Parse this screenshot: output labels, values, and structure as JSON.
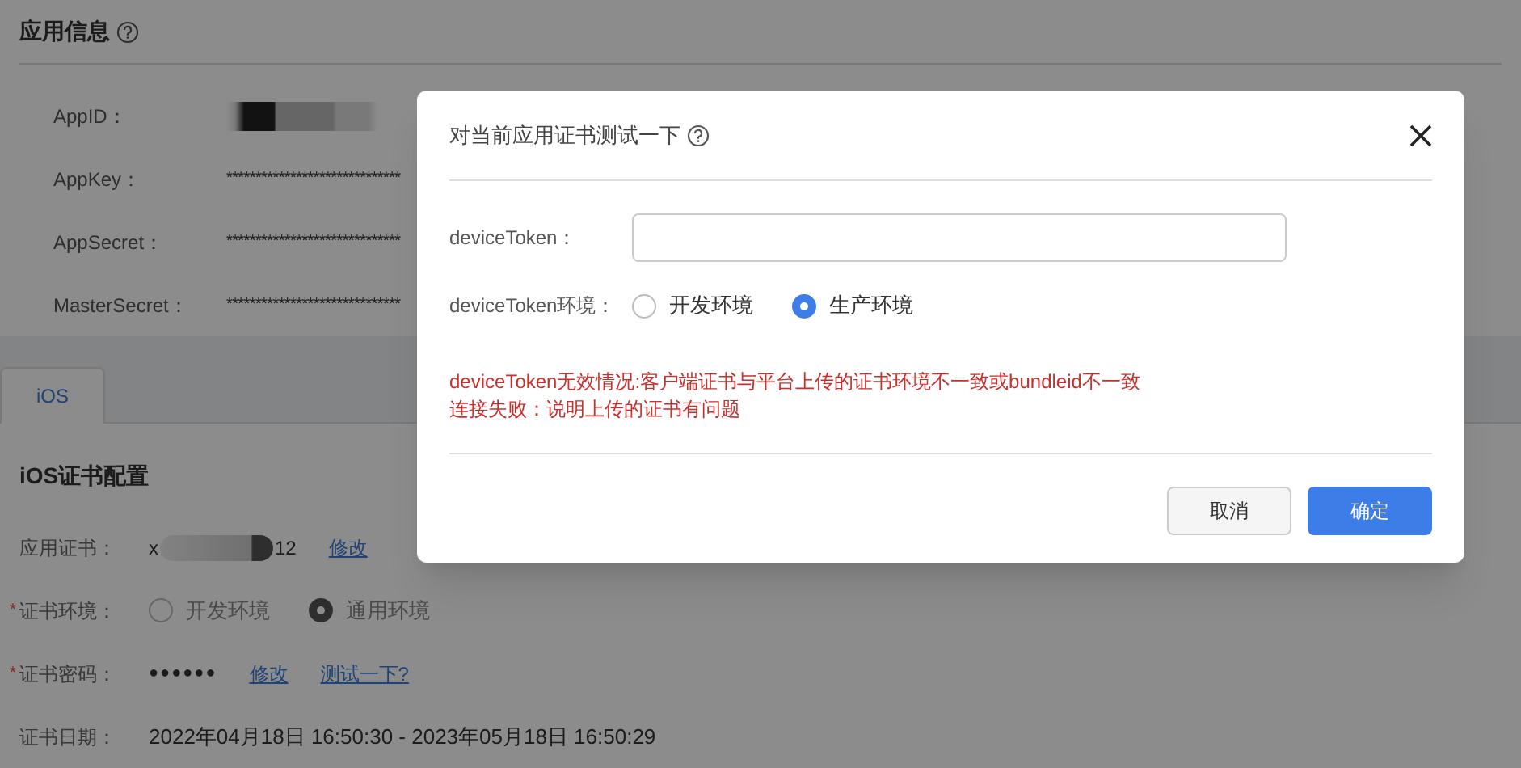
{
  "app_info": {
    "title": "应用信息",
    "fields": [
      {
        "label": "AppID：",
        "kind": "redacted"
      },
      {
        "label": "AppKey：",
        "kind": "masked",
        "value": "******************************"
      },
      {
        "label": "AppSecret：",
        "kind": "masked",
        "value": "******************************"
      },
      {
        "label": "MasterSecret：",
        "kind": "masked",
        "value": "******************************"
      }
    ]
  },
  "tabs": [
    {
      "label": "iOS",
      "selected": true
    }
  ],
  "ios_config": {
    "title": "iOS证书配置",
    "rows": [
      {
        "label": "应用证书：",
        "kind": "cert",
        "value_start": "x",
        "value_end": "12",
        "links": [
          "修改"
        ]
      },
      {
        "label": "证书环境：",
        "required_mark": "*",
        "kind": "radio",
        "options": [
          {
            "label": "开发环境",
            "selected": false
          },
          {
            "label": "通用环境",
            "selected": true
          }
        ]
      },
      {
        "label": "证书密码：",
        "required_mark": "*",
        "kind": "password",
        "value": "●●●●●●",
        "links": [
          "修改",
          "测试一下?"
        ]
      },
      {
        "label": "证书日期：",
        "kind": "text",
        "value": "2022年04月18日 16:50:30 - 2023年05月18日 16:50:29"
      }
    ]
  },
  "dialog": {
    "title": "对当前应用证书测试一下",
    "fields": [
      {
        "label": "deviceToken：",
        "kind": "input"
      },
      {
        "label": "deviceToken环境：",
        "kind": "radio",
        "options": [
          {
            "label": "开发环境",
            "selected": false
          },
          {
            "label": "生产环境",
            "selected": true
          }
        ]
      }
    ],
    "messages": [
      "deviceToken无效情况:客户端证书与平台上传的证书环境不一致或bundleid不一致",
      "连接失败：说明上传的证书有问题"
    ],
    "buttons": [
      {
        "label": "取消",
        "kind": "secondary"
      },
      {
        "label": "确定",
        "kind": "primary"
      }
    ]
  }
}
